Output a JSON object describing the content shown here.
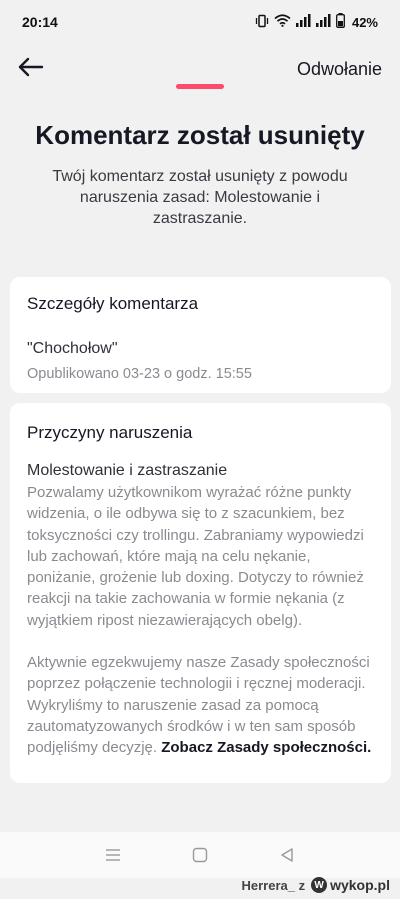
{
  "status_bar": {
    "time": "20:14",
    "battery": "42%",
    "icons": [
      "vibrate-icon",
      "wifi-icon",
      "signal-icon",
      "signal-icon",
      "battery-icon"
    ]
  },
  "nav": {
    "back_icon": "arrow-left-icon",
    "appeal_label": "Odwołanie"
  },
  "colors": {
    "accent": "#fe2c55",
    "background": "#f1f1f2",
    "card": "#ffffff"
  },
  "header": {
    "title": "Komentarz został usunięty",
    "subtitle": "Twój komentarz został usunięty z powodu naruszenia zasad: Molestowanie i zastraszanie."
  },
  "details": {
    "heading": "Szczegóły komentarza",
    "comment": "\"Chochołow\"",
    "published": "Opublikowano 03-23 o godz. 15:55"
  },
  "reasons": {
    "heading": "Przyczyny naruszenia",
    "title": "Molestowanie i zastraszanie",
    "paragraph1": "Pozwalamy użytkownikom wyrażać różne punkty widzenia, o ile odbywa się to z szacunkiem, bez toksyczności czy trollingu. Zabraniamy wypowiedzi lub zachowań, które mają na celu nękanie, poniżanie, grożenie lub doxing. Dotyczy to również reakcji na takie zachowania w formie nękania (z wyjątkiem ripost niezawierających obelg).",
    "paragraph2": "Aktywnie egzekwujemy nasze Zasady społeczności poprzez połączenie technologii i ręcznej moderacji. Wykryliśmy to naruszenie zasad za pomocą zautomatyzowanych środków i w ten sam sposób podjęliśmy decyzję.",
    "link": "Zobacz Zasady społeczności."
  },
  "system_nav": {
    "icons": [
      "menu-icon",
      "home-square-icon",
      "back-triangle-icon"
    ]
  },
  "watermark": {
    "user": "Herrera_ z",
    "brand": "wykop.pl"
  }
}
